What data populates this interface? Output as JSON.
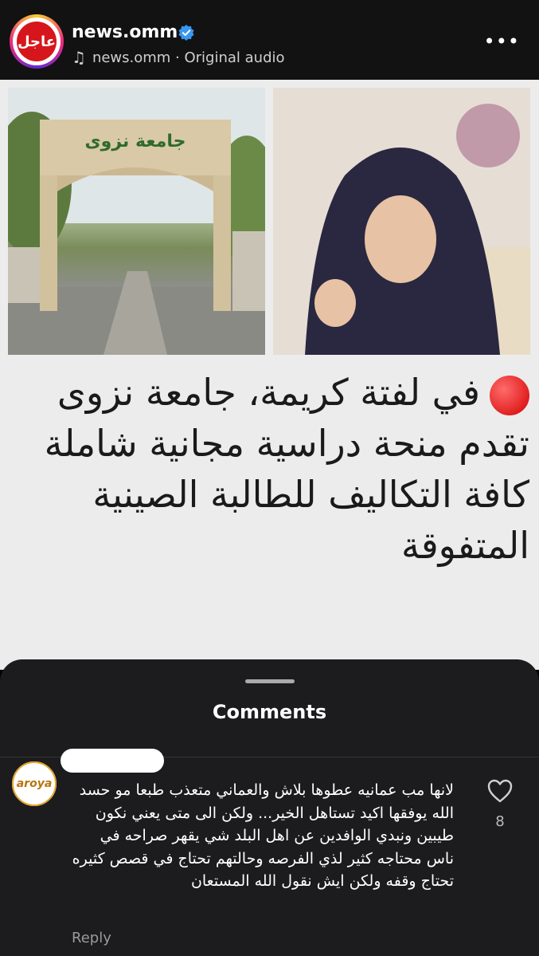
{
  "header": {
    "avatar_text": "عاجل",
    "username": "news.omm",
    "audio": "news.omm · Original audio"
  },
  "post": {
    "text": "في لفتة كريمة، جامعة نزوى تقدم منحة دراسية مجانية شاملة كافة التكاليف للطالبة الصينية المتفوقة",
    "gate_sign": "جامعة نزوى"
  },
  "comments": {
    "title": "Comments",
    "items": [
      {
        "avatar_text": "aroya",
        "text": "لانها مب عمانيه عطوها بلاش والعماني متعذب طبعا مو حسد الله يوفقها اكيد تستاهل الخير... ولكن الى متى يعني نكون طيبين ونبدي الوافدين عن اهل البلد شي يقهر صراحه في ناس محتاجه كثير لذي الفرصه وحالتهم تحتاج في قصص كثيره تحتاج وقفه ولكن ايش نقول الله المستعان",
        "likes": "8",
        "reply_label": "Reply"
      }
    ]
  },
  "colors": {
    "accent_red": "#d6161c",
    "verified_blue": "#3897f0",
    "sheet_bg": "#1c1c1e"
  }
}
